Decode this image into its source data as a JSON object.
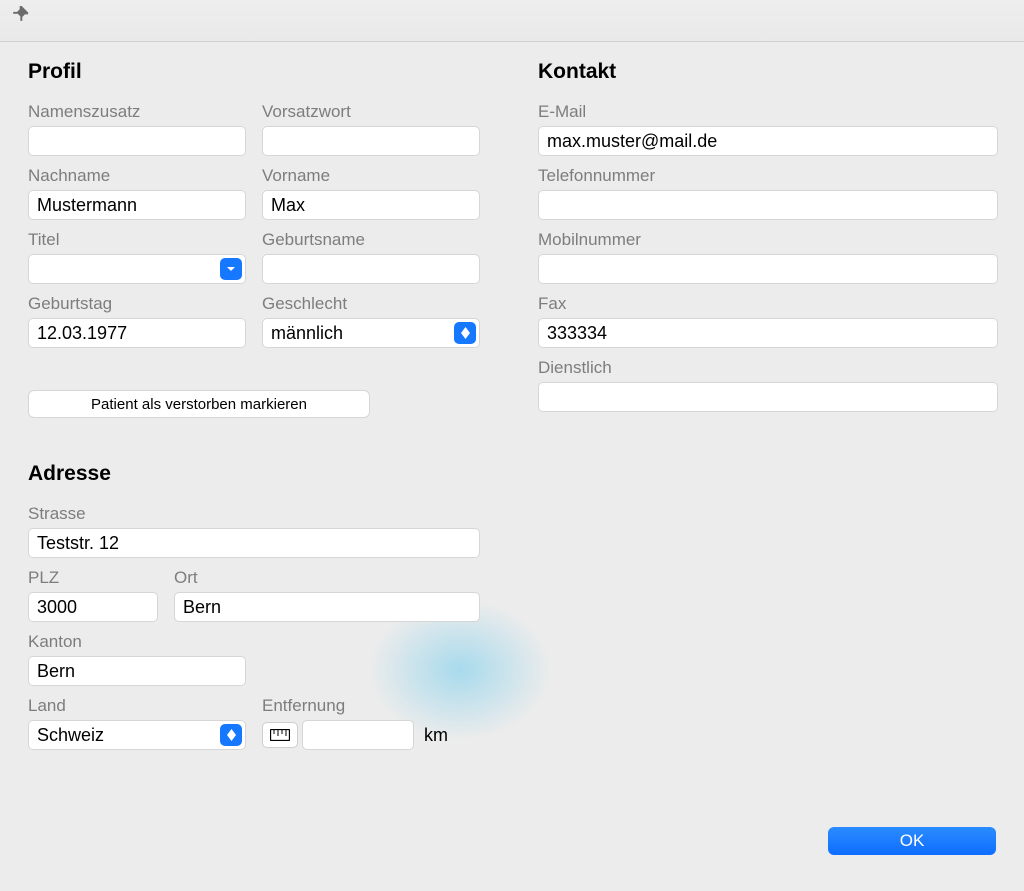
{
  "profil": {
    "heading": "Profil",
    "namenszusatz": {
      "label": "Namenszusatz",
      "value": ""
    },
    "vorsatzwort": {
      "label": "Vorsatzwort",
      "value": ""
    },
    "nachname": {
      "label": "Nachname",
      "value": "Mustermann"
    },
    "vorname": {
      "label": "Vorname",
      "value": "Max"
    },
    "titel": {
      "label": "Titel",
      "value": ""
    },
    "geburtsname": {
      "label": "Geburtsname",
      "value": ""
    },
    "geburtstag": {
      "label": "Geburtstag",
      "value": "12.03.1977"
    },
    "geschlecht": {
      "label": "Geschlecht",
      "value": "männlich"
    },
    "verstorben_button": "Patient als verstorben markieren"
  },
  "kontakt": {
    "heading": "Kontakt",
    "email": {
      "label": "E-Mail",
      "value": "max.muster@mail.de"
    },
    "telefon": {
      "label": "Telefonnummer",
      "value": ""
    },
    "mobil": {
      "label": "Mobilnummer",
      "value": ""
    },
    "fax": {
      "label": "Fax",
      "value": "333334"
    },
    "dienstlich": {
      "label": "Dienstlich",
      "value": ""
    }
  },
  "adresse": {
    "heading": "Adresse",
    "strasse": {
      "label": "Strasse",
      "value": "Teststr. 12"
    },
    "plz": {
      "label": "PLZ",
      "value": "3000"
    },
    "ort": {
      "label": "Ort",
      "value": "Bern"
    },
    "kanton": {
      "label": "Kanton",
      "value": "Bern"
    },
    "land": {
      "label": "Land",
      "value": "Schweiz"
    },
    "entfernung": {
      "label": "Entfernung",
      "value": "",
      "unit": "km"
    }
  },
  "ok_button": "OK"
}
